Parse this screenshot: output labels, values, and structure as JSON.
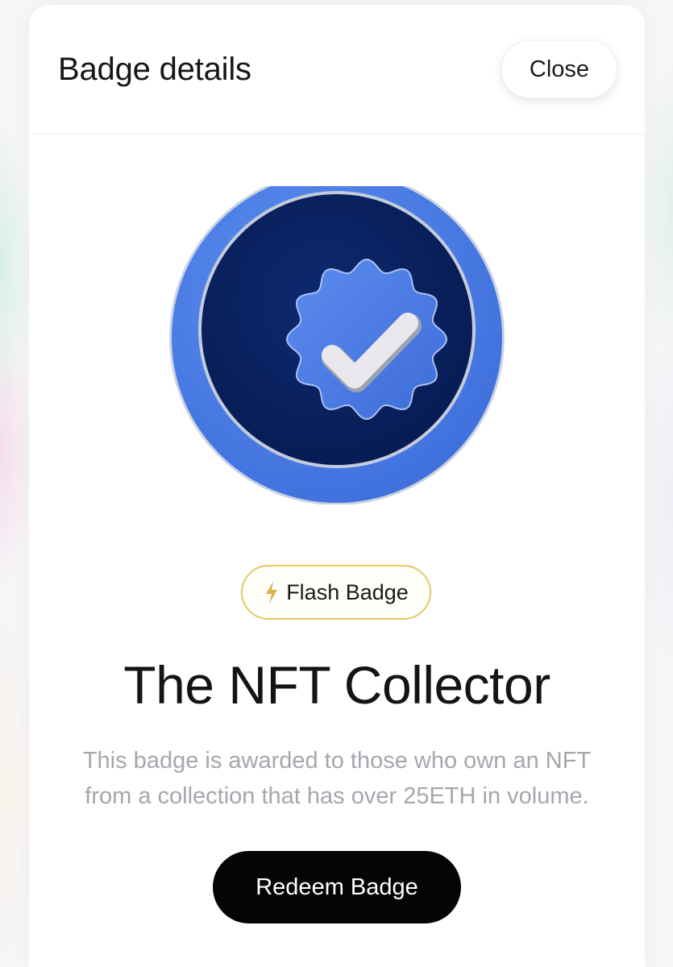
{
  "modal": {
    "title": "Badge details",
    "close_label": "Close"
  },
  "badge": {
    "image_icon": "verified-checkmark-badge-icon",
    "type_icon": "lightning-bolt-icon",
    "type_label": "Flash Badge",
    "name": "The NFT Collector",
    "description": "This badge is awarded to those who own an NFT from a collection that has over 25ETH in volume."
  },
  "actions": {
    "redeem_label": "Redeem Badge"
  },
  "colors": {
    "outer_ring": "#4d80ea",
    "inner_disc": "#0b2466",
    "seal": "#4a7ce6",
    "check": "#e9e7ec",
    "chip_border": "#e3cb63",
    "primary_button": "#050505"
  }
}
